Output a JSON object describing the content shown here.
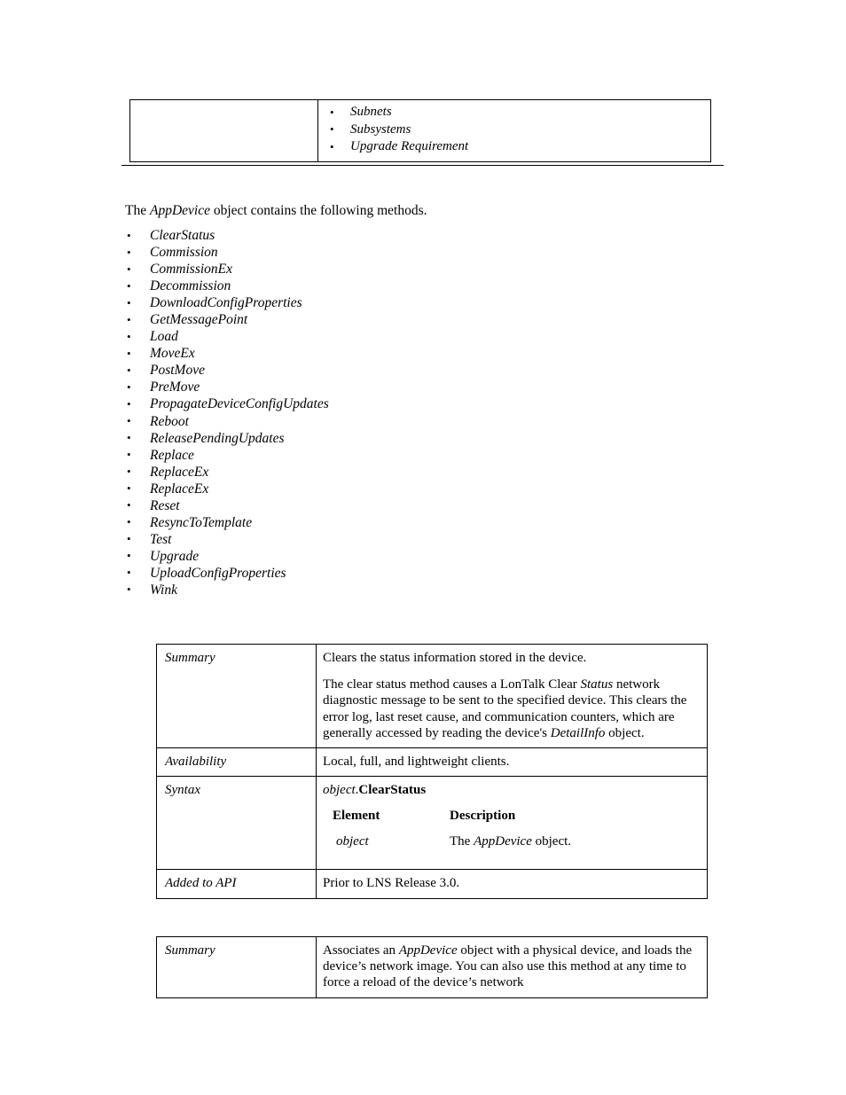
{
  "document": {
    "top_table": {
      "left_cell": "",
      "bullets": [
        "Subnets",
        "Subsystems",
        "Upgrade Requirement"
      ]
    },
    "intro": {
      "before": "The ",
      "object_name": "AppDevice",
      "after": " object contains the following methods."
    },
    "methods": [
      "ClearStatus",
      "Commission",
      "CommissionEx",
      "Decommission",
      "DownloadConfigProperties",
      "GetMessagePoint",
      "Load",
      "MoveEx",
      "PostMove",
      "PreMove",
      "PropagateDeviceConfigUpdates",
      "Reboot",
      "ReleasePendingUpdates",
      "Replace",
      "ReplaceEx",
      "ReplaceEx",
      "Reset",
      "ResyncToTemplate",
      "Test",
      "Upgrade",
      "UploadConfigProperties",
      "Wink"
    ],
    "clear_status_table": {
      "labels": {
        "summary": "Summary",
        "availability": "Availability",
        "syntax": "Syntax",
        "added_to_api": "Added to API"
      },
      "summary": {
        "paragraph1": "Clears the status information stored in the device.",
        "paragraph2_part1": "The clear status method causes a LonTalk Clear ",
        "paragraph2_italic1": "Status",
        "paragraph2_part2": " network diagnostic message to be sent to the specified device. This clears the error log, last reset cause, and communication counters, which are generally accessed by reading the device's ",
        "paragraph2_italic2": "DetailInfo",
        "paragraph2_part3": " object."
      },
      "availability": "Local, full, and lightweight clients.",
      "syntax": {
        "object_word": "object",
        "separator": ".",
        "method_name": "ClearStatus",
        "grid_headers": {
          "element": "Element",
          "description": "Description"
        },
        "rows": [
          {
            "element": "object",
            "description_before": "The ",
            "description_italic": "AppDevice",
            "description_after": "  object."
          }
        ]
      },
      "added_to_api": "Prior to LNS Release 3.0."
    },
    "commission_table": {
      "labels": {
        "summary": "Summary"
      },
      "summary_line1_before": "Associates an ",
      "summary_line1_italic": "AppDevice",
      "summary_line1_after": "  object with a physical device, and loads the device’s network image. You can also use this method at any time to force a reload of the device’s network"
    }
  }
}
